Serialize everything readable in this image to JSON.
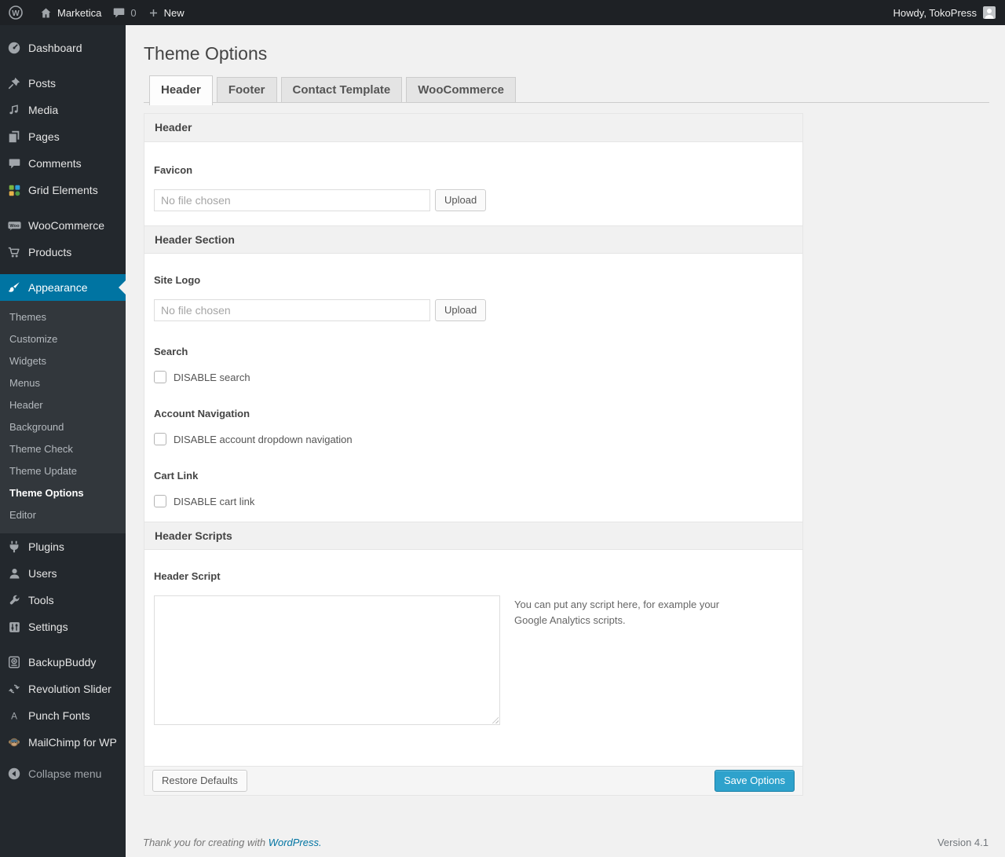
{
  "admin_bar": {
    "site_name": "Marketica",
    "comment_count": "0",
    "new_label": "New",
    "howdy": "Howdy, TokoPress"
  },
  "sidebar": {
    "items": [
      "Dashboard",
      "Posts",
      "Media",
      "Pages",
      "Comments",
      "Grid Elements",
      "WooCommerce",
      "Products"
    ],
    "appearance_label": "Appearance",
    "submenu": [
      "Themes",
      "Customize",
      "Widgets",
      "Menus",
      "Header",
      "Background",
      "Theme Check",
      "Theme Update",
      "Theme Options",
      "Editor"
    ],
    "lower_items": [
      "Plugins",
      "Users",
      "Tools",
      "Settings"
    ],
    "plugin_items": [
      "BackupBuddy",
      "Revolution Slider",
      "Punch Fonts",
      "MailChimp for WP"
    ],
    "collapse_label": "Collapse menu"
  },
  "page": {
    "title": "Theme Options",
    "tabs": [
      "Header",
      "Footer",
      "Contact Template",
      "WooCommerce"
    ]
  },
  "sections": {
    "header": {
      "title": "Header",
      "favicon_label": "Favicon"
    },
    "header_section": {
      "title": "Header Section",
      "site_logo_label": "Site Logo",
      "search_label": "Search",
      "disable_search_label": "DISABLE search",
      "account_nav_label": "Account Navigation",
      "disable_account_label": "DISABLE account dropdown navigation",
      "cart_link_label": "Cart Link",
      "disable_cart_label": "DISABLE cart link"
    },
    "header_scripts": {
      "title": "Header Scripts",
      "script_label": "Header Script",
      "help_text": "You can put any script here, for example your Google Analytics scripts."
    }
  },
  "fields": {
    "file_placeholder": "No file chosen",
    "upload_label": "Upload"
  },
  "actions": {
    "restore_label": "Restore Defaults",
    "save_label": "Save Options"
  },
  "footer": {
    "thanks_text": "Thank you for creating with",
    "wordpress_link": "WordPress.",
    "version": "Version 4.1"
  },
  "icons": {
    "wp_logo_letter": "W",
    "woo_badge": "Woo",
    "punch_fonts_letter": "A"
  },
  "colors": {
    "accent": "#0074a2",
    "primary_button": "#2ea2cc",
    "sidebar_bg": "#23282d",
    "adminbar_bg": "#1e2125"
  }
}
